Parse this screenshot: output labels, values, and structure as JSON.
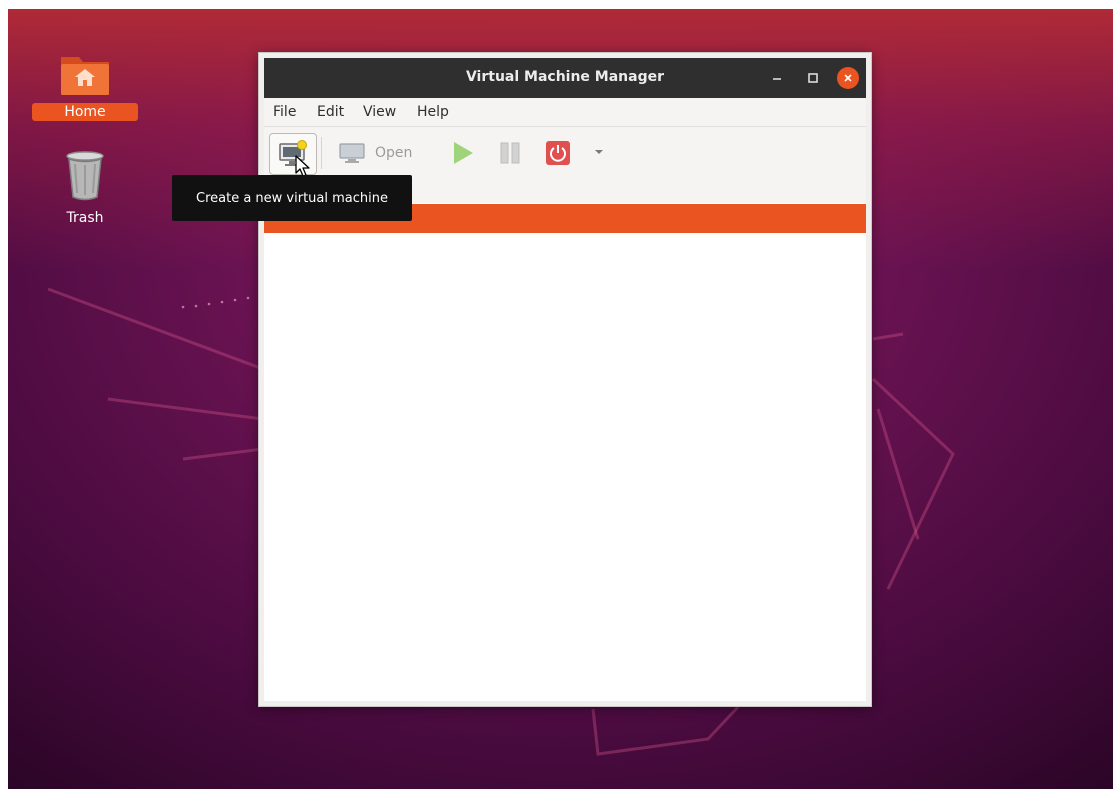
{
  "desktop": {
    "icons": [
      {
        "label": "Home",
        "icon": "home-folder-icon"
      },
      {
        "label": "Trash",
        "icon": "trash-icon"
      }
    ]
  },
  "window": {
    "title": "Virtual Machine Manager",
    "controls": {
      "minimize": "minimize-icon",
      "maximize": "maximize-icon",
      "close": "close-icon"
    }
  },
  "menubar": {
    "items": [
      "File",
      "Edit",
      "View",
      "Help"
    ]
  },
  "toolbar": {
    "new_vm": {
      "icon": "new-vm-monitor-icon"
    },
    "open": {
      "label": "Open",
      "icon": "monitor-icon"
    },
    "run": {
      "icon": "play-icon"
    },
    "pause": {
      "icon": "pause-icon"
    },
    "shutdown": {
      "icon": "power-icon"
    },
    "more": {
      "icon": "chevron-down-icon"
    }
  },
  "tooltip": {
    "text": "Create a new virtual machine"
  },
  "colors": {
    "accent": "#e95420",
    "titlebar": "#2f2f2f",
    "run_green": "#9fd47a",
    "shutdown_red": "#e0504f"
  }
}
